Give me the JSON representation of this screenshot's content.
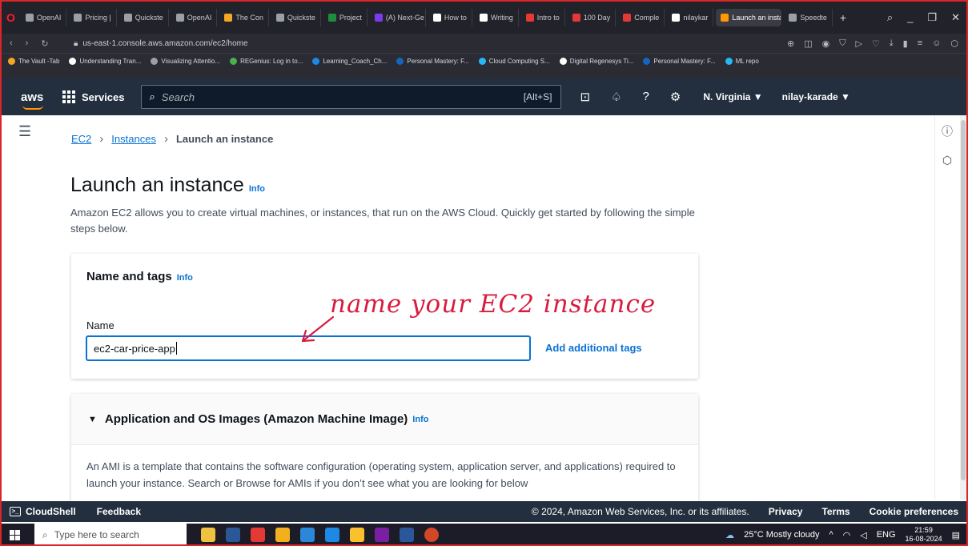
{
  "browser": {
    "tabs": [
      {
        "label": "OpenAI",
        "color": "#9aa0a6"
      },
      {
        "label": "Pricing |",
        "color": "#9aa0a6"
      },
      {
        "label": "Quickste",
        "color": "#9aa0a6"
      },
      {
        "label": "OpenAI",
        "color": "#9aa0a6"
      },
      {
        "label": "The Con",
        "color": "#f5a623"
      },
      {
        "label": "Quickste",
        "color": "#9aa0a6"
      },
      {
        "label": "Project",
        "color": "#1e8e3e"
      },
      {
        "label": "(A) Next-Ge",
        "color": "#7c3aed"
      },
      {
        "label": "How to",
        "color": "#ffffff"
      },
      {
        "label": "Writing",
        "color": "#ffffff"
      },
      {
        "label": "Intro to",
        "color": "#e53935"
      },
      {
        "label": "100 Day",
        "color": "#e53935"
      },
      {
        "label": "Comple",
        "color": "#e53935"
      },
      {
        "label": "nilaykar",
        "color": "#ffffff"
      },
      {
        "label": "Launch an insta",
        "color": "#f90",
        "active": true
      },
      {
        "label": "Speedte",
        "color": "#9aa0a6"
      }
    ],
    "url": "us-east-1.console.aws.amazon.com/ec2/home",
    "bookmarks": [
      {
        "label": "The Vault -Tab",
        "color": "#f5a623"
      },
      {
        "label": "Understanding Tran...",
        "color": "#ffffff"
      },
      {
        "label": "Visualizing Attentio...",
        "color": "#9aa0a6"
      },
      {
        "label": "REGenius: Log in to...",
        "color": "#4caf50"
      },
      {
        "label": "Learning_Coach_Ch...",
        "color": "#1e88e5"
      },
      {
        "label": "Personal Mastery: F...",
        "color": "#1565c0"
      },
      {
        "label": "Cloud Computing S...",
        "color": "#29b6f6"
      },
      {
        "label": "Digital Regenesys Ti...",
        "color": "#ffffff"
      },
      {
        "label": "Personal Mastery: F...",
        "color": "#1565c0"
      },
      {
        "label": "ML repo",
        "color": "#29b6f6"
      }
    ]
  },
  "aws_header": {
    "logo": "aws",
    "services": "Services",
    "search_placeholder": "Search",
    "search_shortcut": "[Alt+S]",
    "region": "N. Virginia ▼",
    "user": "nilay-karade ▼"
  },
  "breadcrumb": {
    "root": "EC2",
    "section": "Instances",
    "current": "Launch an instance"
  },
  "page": {
    "title": "Launch an instance",
    "info": "Info",
    "description": "Amazon EC2 allows you to create virtual machines, or instances, that run on the AWS Cloud. Quickly get started by following the simple steps below."
  },
  "name_tags": {
    "heading": "Name and tags",
    "info": "Info",
    "name_label": "Name",
    "name_value": "ec2-car-price-app",
    "add_tags": "Add additional tags"
  },
  "ami": {
    "heading": "Application and OS Images (Amazon Machine Image)",
    "info": "Info",
    "body": "An AMI is a template that contains the software configuration (operating system, application server, and applications) required to launch your instance. Search or Browse for AMIs if you don’t see what you are looking for below"
  },
  "annotation": "name your EC2 instance",
  "footer": {
    "cloudshell": "CloudShell",
    "feedback": "Feedback",
    "copyright": "© 2024, Amazon Web Services, Inc. or its affiliates.",
    "privacy": "Privacy",
    "terms": "Terms",
    "cookies": "Cookie preferences"
  },
  "taskbar": {
    "search_placeholder": "Type here to search",
    "weather": "25°C  Mostly cloudy",
    "lang": "ENG",
    "time": "21:59",
    "date": "16-08-2024"
  }
}
